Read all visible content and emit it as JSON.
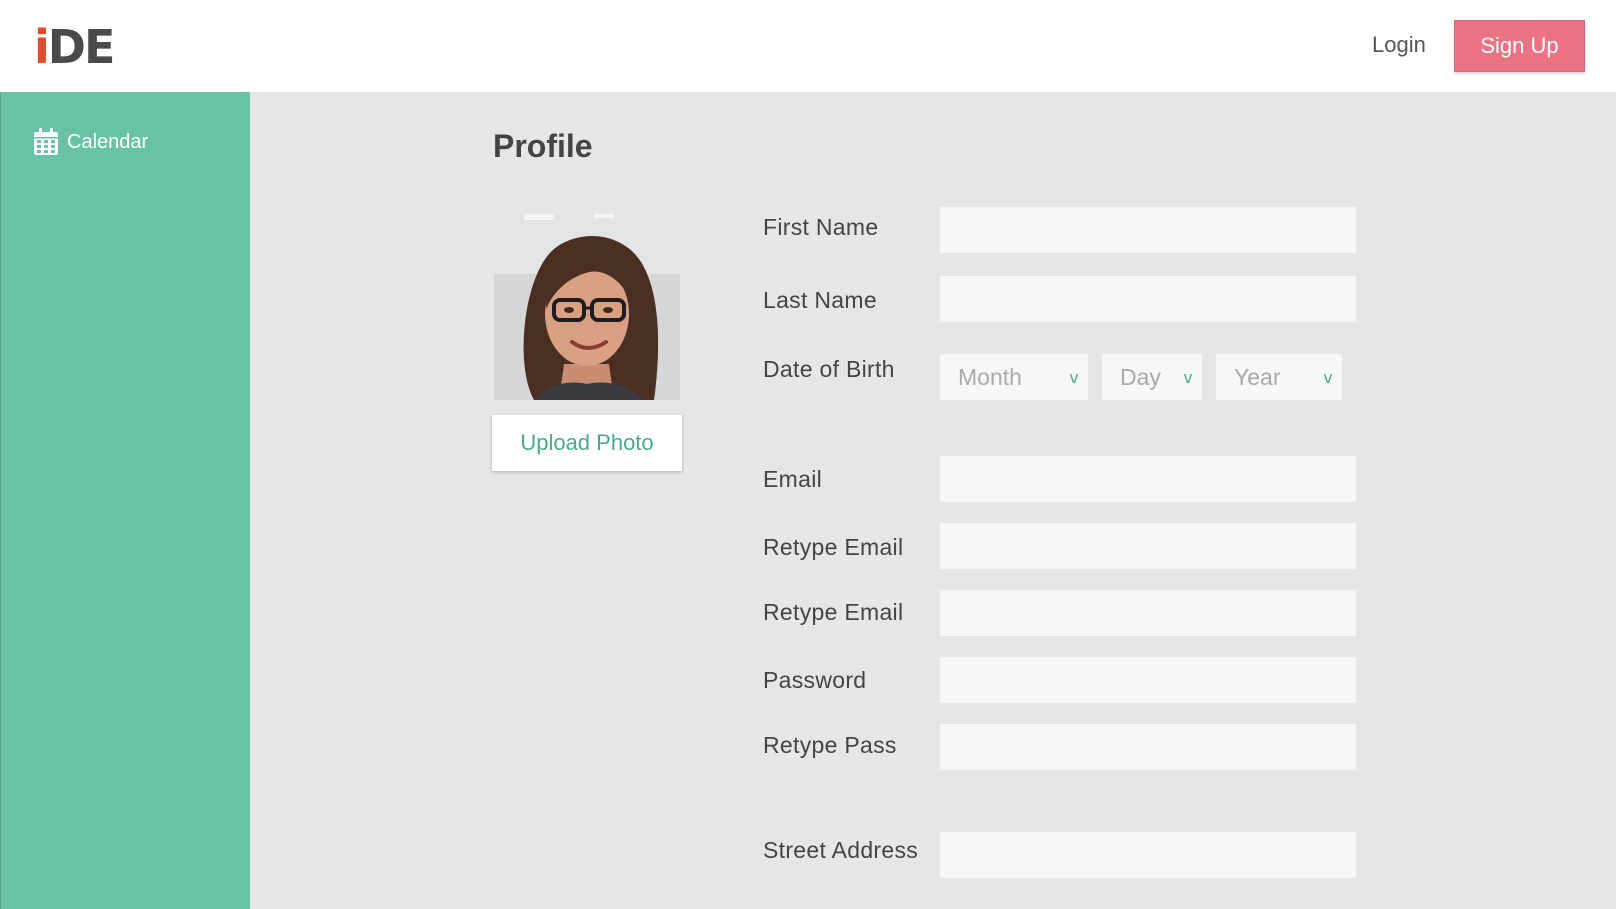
{
  "header": {
    "logo_i": "i",
    "logo_rest": "DE",
    "login_label": "Login",
    "signup_label": "Sign Up"
  },
  "sidebar": {
    "items": [
      {
        "label": "Calendar",
        "icon": "calendar-icon"
      }
    ]
  },
  "main": {
    "title": "Profile",
    "upload_label": "Upload Photo",
    "form": {
      "first_name": {
        "label": "First Name",
        "value": ""
      },
      "last_name": {
        "label": "Last Name",
        "value": ""
      },
      "dob": {
        "label": "Date of Birth",
        "month_placeholder": "Month",
        "day_placeholder": "Day",
        "year_placeholder": "Year",
        "chevron": "v"
      },
      "email": {
        "label": "Email",
        "value": ""
      },
      "retype_email_1": {
        "label": "Retype Email",
        "value": ""
      },
      "retype_email_2": {
        "label": "Retype Email",
        "value": ""
      },
      "password": {
        "label": "Password",
        "value": ""
      },
      "retype_pass": {
        "label": "Retype Pass",
        "value": ""
      },
      "street_address": {
        "label": "Street Address",
        "value": ""
      }
    }
  },
  "colors": {
    "accent_green": "#6ac2a4",
    "signup_pink": "#ec7384",
    "logo_red": "#e24a2e",
    "background": "#e6e6e6"
  }
}
